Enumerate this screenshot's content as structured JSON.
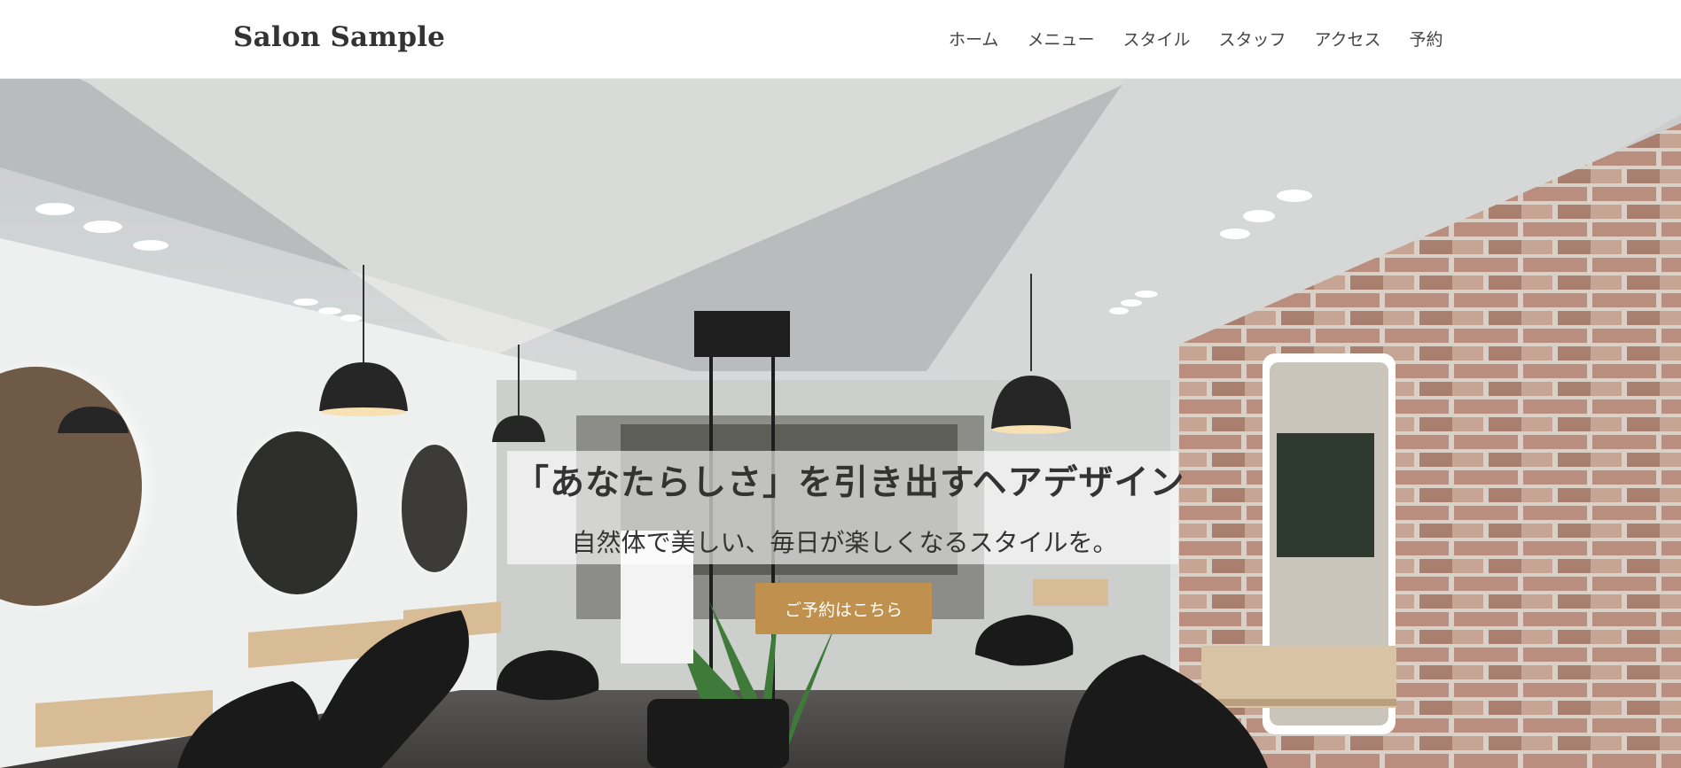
{
  "header": {
    "logo": "Salon Sample",
    "nav": [
      "ホーム",
      "メニュー",
      "スタイル",
      "スタッフ",
      "アクセス",
      "予約"
    ]
  },
  "hero": {
    "title": "「あなたらしさ」を引き出すヘアデザイン",
    "subtitle": "自然体で美しい、毎日が楽しくなるスタイルを。",
    "cta_label": "ご予約はこちら",
    "image": "salon-interior-photo"
  },
  "colors": {
    "accent": "#c0904f",
    "text": "#333333",
    "header_bg": "#ffffff"
  }
}
